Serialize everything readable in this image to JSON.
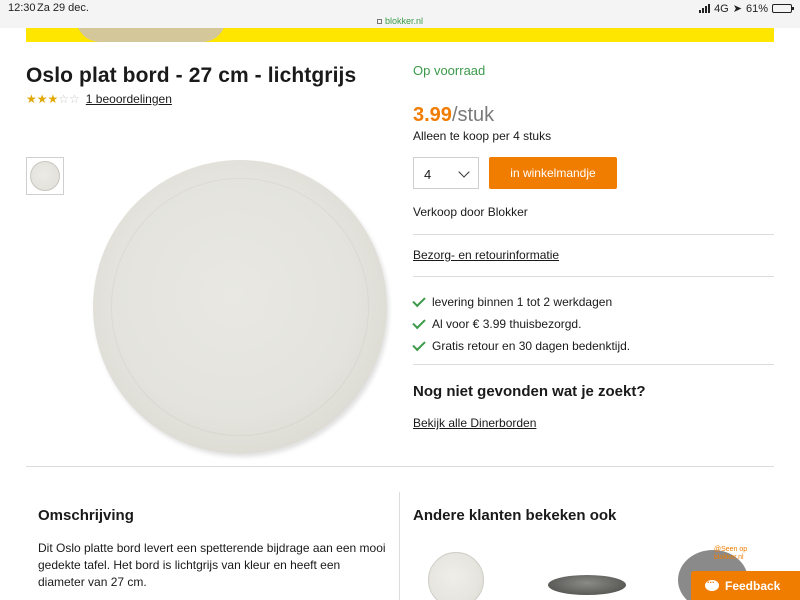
{
  "status_bar": {
    "time": "12:30",
    "date": "Za 29 dec.",
    "network": "4G",
    "battery": "61%",
    "battery_level": 0.61
  },
  "browser": {
    "url": "blokker.nl"
  },
  "product": {
    "title": "Oslo plat bord - 27 cm - lichtgrijs",
    "rating": {
      "stars_filled": 3,
      "stars_total": 5,
      "reviews_label": "1 beoordelingen"
    },
    "stock": "Op voorraad",
    "price": {
      "amount": "3.99",
      "unit": "/stuk"
    },
    "sold_per": "Alleen te koop per 4 stuks",
    "quantity": "4",
    "cart_button": "in winkelmandje",
    "seller": "Verkoop door Blokker",
    "shipping_link": "Bezorg- en retourinformatie",
    "usps": [
      "levering binnen 1 tot 2 werkdagen",
      "Al voor € 3.99 thuisbezorgd.",
      "Gratis retour en 30 dagen bedenktijd."
    ]
  },
  "not_found": {
    "heading": "Nog niet gevonden wat je zoekt?",
    "link": "Bekijk alle Dinerborden"
  },
  "description": {
    "heading": "Omschrijving",
    "text": "Dit Oslo platte bord levert een spetterende bijdrage aan een mooi gedekte tafel. Het bord is lichtgrijs van kleur en heeft een diameter van 27 cm."
  },
  "others": {
    "heading": "Andere klanten bekeken ook",
    "tag_line1": "@Seen op",
    "tag_line2": "blokker.nl"
  },
  "feedback_button": "Feedback",
  "colors": {
    "accent": "#f07c00",
    "stock_green": "#3c9a4a",
    "banner_yellow": "#ffe600"
  }
}
